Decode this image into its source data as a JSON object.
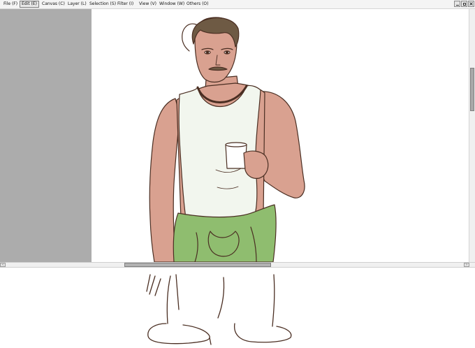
{
  "menu": {
    "items": [
      {
        "label": "File (F)"
      },
      {
        "label": "Edit (E)"
      },
      {
        "label": "Canvas (C)"
      },
      {
        "label": "Layer (L)"
      },
      {
        "label": "Selection (S)"
      },
      {
        "label": "Filter (I)"
      },
      {
        "label": "View (V)"
      },
      {
        "label": "Window (W)"
      },
      {
        "label": "Others (O)"
      }
    ],
    "active_item": "Edit (E)"
  },
  "window_buttons": [
    "minimize-icon",
    "restore-icon",
    "close-icon"
  ],
  "colors": {
    "menubar_bg": "#f4f4f4",
    "panel_gray": "#acacac",
    "skin": "#d9a190",
    "tank_top": "#f2f6ee",
    "sweater": "#8fbd6f",
    "hair": "#6e5a44",
    "outline": "#4a2e22"
  }
}
